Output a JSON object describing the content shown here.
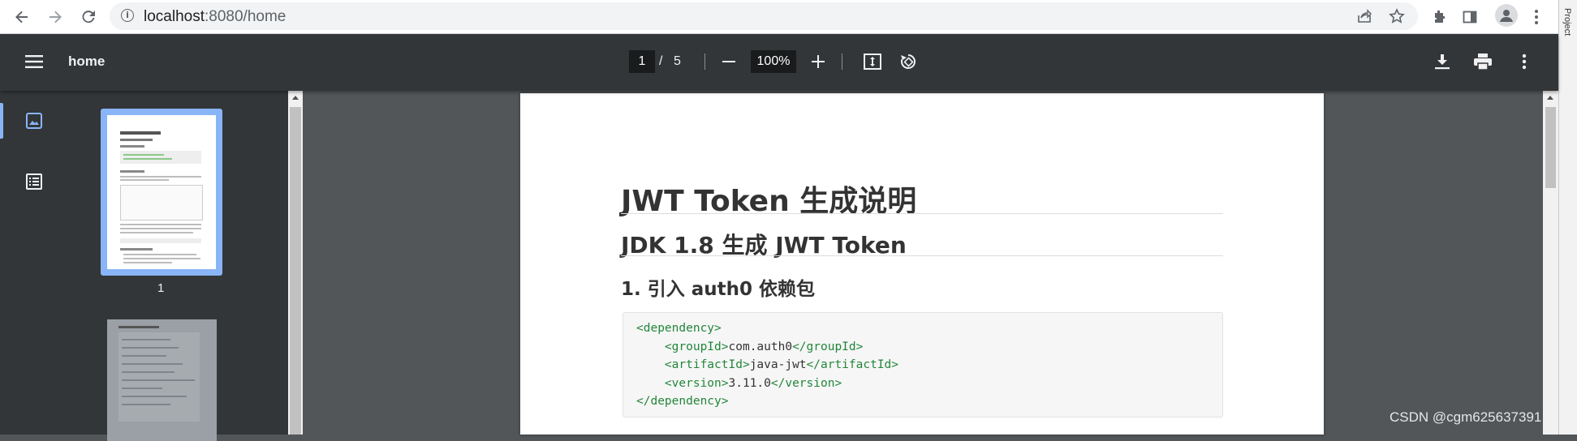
{
  "browser": {
    "url_host": "localhost",
    "url_rest": ":8080/home",
    "back_icon": "arrow-left-icon",
    "forward_icon": "arrow-right-icon",
    "reload_icon": "reload-icon"
  },
  "ide_strip": {
    "label": "Project"
  },
  "pdf_toolbar": {
    "title": "home",
    "current_page": "1",
    "page_separator": "/",
    "total_pages": "5",
    "zoom": "100%"
  },
  "sidebar": {
    "thumbnails": [
      {
        "label": "1"
      }
    ]
  },
  "document": {
    "h1": "JWT Token 生成说明",
    "h2": "JDK 1.8 生成 JWT Token",
    "h3": "1. 引入 auth0 依赖包",
    "code_lines": [
      {
        "open": "<dependency>",
        "text": "",
        "close": ""
      },
      {
        "open": "<groupId>",
        "text": "com.auth0",
        "close": "</groupId>"
      },
      {
        "open": "<artifactId>",
        "text": "java-jwt",
        "close": "</artifactId>"
      },
      {
        "open": "<version>",
        "text": "3.11.0",
        "close": "</version>"
      },
      {
        "open": "</dependency>",
        "text": "",
        "close": ""
      }
    ]
  },
  "watermark": "CSDN @cgm625637391",
  "colors": {
    "toolbar_bg": "#323639",
    "viewer_bg": "#525659",
    "thumb_selected": "#8ab4f8",
    "code_tag": "#22863a"
  }
}
